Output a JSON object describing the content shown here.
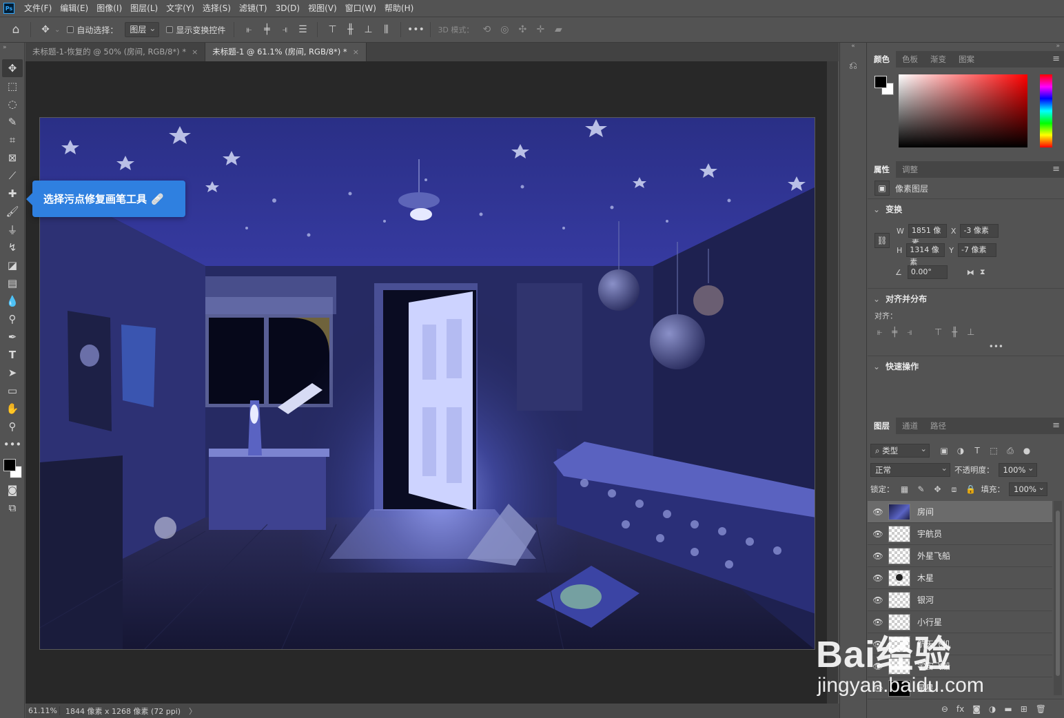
{
  "app": {
    "logo": "Ps"
  },
  "menu": [
    "文件(F)",
    "编辑(E)",
    "图像(I)",
    "图层(L)",
    "文字(Y)",
    "选择(S)",
    "滤镜(T)",
    "3D(D)",
    "视图(V)",
    "窗口(W)",
    "帮助(H)"
  ],
  "options": {
    "auto_select_label": "自动选择：",
    "auto_select_target": "图层",
    "show_transform_label": "显示变换控件",
    "mode_3d_label": "3D 模式：",
    "more": "•••"
  },
  "tabs": [
    {
      "label": "未标题-1-恢复的 @ 50% (房间, RGB/8*) *",
      "close": "×",
      "active": false
    },
    {
      "label": "未标题-1 @ 61.1% (房间, RGB/8*) *",
      "close": "×",
      "active": true
    }
  ],
  "callout": {
    "text": "选择污点修复画笔工具",
    "icon": "🩹"
  },
  "status": {
    "zoom": "61.11%",
    "doc_info": "1844 像素 x 1268 像素 (72 ppi)",
    "arrow": "〉"
  },
  "color_panel": {
    "tabs": [
      "颜色",
      "色板",
      "渐变",
      "图案"
    ],
    "foreground": "#000000",
    "background": "#ffffff"
  },
  "properties_panel": {
    "tabs": [
      "属性",
      "调整"
    ],
    "layer_type": "像素图层",
    "transform": {
      "title": "变换",
      "w_label": "W",
      "w_value": "1851 像素",
      "x_label": "X",
      "x_value": "-3 像素",
      "h_label": "H",
      "h_value": "1314 像素",
      "y_label": "Y",
      "y_value": "-7 像素",
      "angle": "0.00°"
    },
    "align": {
      "title": "对齐并分布",
      "label": "对齐：",
      "more": "•••"
    },
    "quick_actions": {
      "title": "快速操作"
    }
  },
  "layers_panel": {
    "tabs": [
      "图层",
      "通道",
      "路径"
    ],
    "filter_kind": "类型",
    "blend_mode": "正常",
    "opacity_label": "不透明度：",
    "opacity_value": "100%",
    "lock_label": "锁定：",
    "fill_label": "填充：",
    "fill_value": "100%",
    "layers": [
      {
        "name": "房间",
        "thumb": "room",
        "selected": true
      },
      {
        "name": "宇航员",
        "thumb": "transparent",
        "selected": false
      },
      {
        "name": "外星飞船",
        "thumb": "transparent",
        "selected": false
      },
      {
        "name": "木星",
        "thumb": "planet",
        "selected": false
      },
      {
        "name": "银河",
        "thumb": "transparent",
        "selected": false
      },
      {
        "name": "小行星",
        "thumb": "transparent",
        "selected": false
      },
      {
        "name": "航天飞机",
        "thumb": "transparent",
        "selected": false
      },
      {
        "name": "宇宙飞船",
        "thumb": "transparent",
        "selected": false
      },
      {
        "name": "星星",
        "thumb": "black",
        "selected": false
      }
    ],
    "footer": [
      "⊖",
      "fx",
      "◙",
      "◑",
      "▬",
      "⊞",
      "🗑"
    ]
  },
  "watermark": {
    "brand": "Bai经验",
    "url": "jingyan.baidu.com"
  }
}
